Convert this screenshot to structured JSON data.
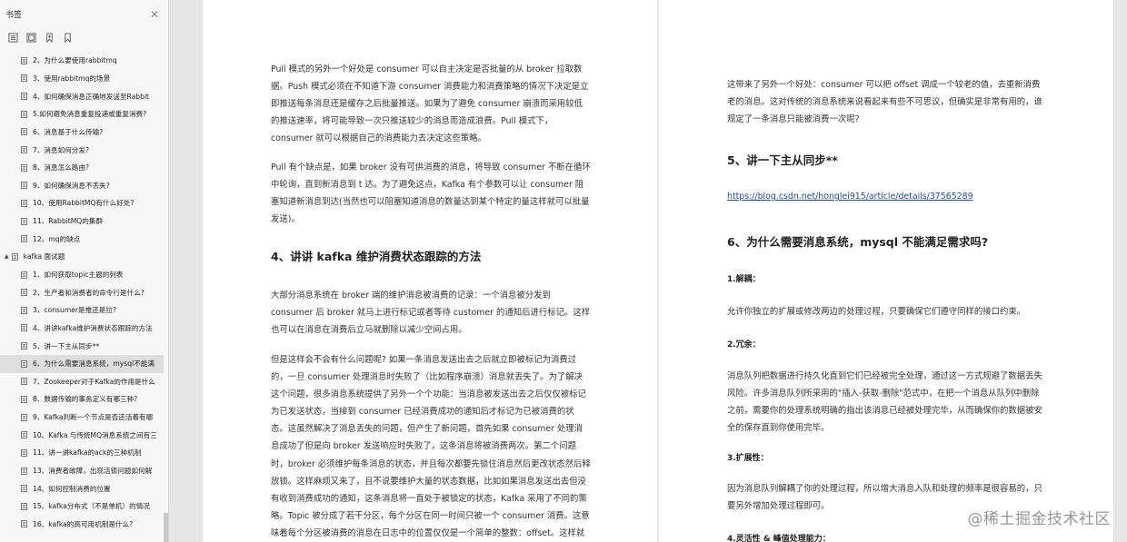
{
  "sidebar": {
    "title": "书签",
    "close_icon": "✕",
    "tools": [
      "expand-all-icon",
      "collapse-all-icon",
      "bookmark-add-icon",
      "bookmark-icon"
    ],
    "items": [
      {
        "label": "2、为什么要使用rabbitmq",
        "level": "child"
      },
      {
        "label": "3、使用rabbitmq的场景",
        "level": "child"
      },
      {
        "label": "4、如何确保消息正确地发送至Rabbit",
        "level": "child"
      },
      {
        "label": "5.如何避免消息重复投递或重复消费?",
        "level": "child"
      },
      {
        "label": "6、消息基于什么传输?",
        "level": "child"
      },
      {
        "label": "7、消息如何分发?",
        "level": "child"
      },
      {
        "label": "8、消息怎么路由?",
        "level": "child"
      },
      {
        "label": "9、如何确保消息不丢失?",
        "level": "child"
      },
      {
        "label": "10、使用RabbitMQ有什么好处?",
        "level": "child"
      },
      {
        "label": "11、RabbitMQ的集群",
        "level": "child"
      },
      {
        "label": "12、mq的缺点",
        "level": "child"
      },
      {
        "label": "kafka 面试题",
        "level": "parent"
      },
      {
        "label": "1、如何获取topic主题的列表",
        "level": "child"
      },
      {
        "label": "2、生产者和消费者的命令行是什么?",
        "level": "child"
      },
      {
        "label": "3、consumer是推还是拉?",
        "level": "child"
      },
      {
        "label": "4、讲讲kafka维护消费状态跟踪的方法",
        "level": "child"
      },
      {
        "label": "5、讲一下主从同步**",
        "level": "child"
      },
      {
        "label": "6、为什么需要消息系统，mysql不能满",
        "level": "child",
        "selected": true
      },
      {
        "label": "7、Zookeeper对于Kafka的作用是什么",
        "level": "child"
      },
      {
        "label": "8、数据传输的事务定义有哪三种?",
        "level": "child"
      },
      {
        "label": "9、Kafka判断一个节点是否还活着有哪",
        "level": "child"
      },
      {
        "label": "10、Kafka 与传统MQ消息系统之间有三",
        "level": "child"
      },
      {
        "label": "11、讲一讲kafka的ack的三种机制",
        "level": "child"
      },
      {
        "label": "13、消费者故障，出现活锁问题如何解",
        "level": "child"
      },
      {
        "label": "14、如何控制消费的位置",
        "level": "child"
      },
      {
        "label": "15、kafka分布式（不是单机）的情况",
        "level": "child"
      },
      {
        "label": "16、kafka的高可用机制是什么?",
        "level": "child"
      }
    ]
  },
  "left_page": {
    "para1": "Pull 模式的另外一个好处是 consumer 可以自主决定是否批量的从 broker 拉取数据。Push 模式必须在不知道下游 consumer 消费能力和消费策略的情况下决定是立即推送每条消息还是缓存之后批量推送。如果为了避免 consumer 崩溃而采用较低的推送速率，将可能导致一次只推送较少的消息而造成浪费。Pull 模式下，consumer 就可以根据自己的消费能力去决定这些策略。",
    "para2": "Pull 有个缺点是，如果 broker 没有可供消费的消息，将导致 consumer 不断在循环中轮询，直到新消息到 t 达。为了避免这点，Kafka 有个参数可以让 consumer 阻塞知道新消息到达(当然也可以阻塞知道消息的数量达到某个特定的量这样就可以批量发送)。",
    "heading4": "4、讲讲 kafka 维护消费状态跟踪的方法",
    "para3": "大部分消息系统在 broker 端的维护消息被消费的记录：一个消息被分发到 consumer 后 broker 就马上进行标记或者等待 customer 的通知后进行标记。这样也可以在消息在消费后立马就删除以减少空间占用。",
    "para4": "但是这样会不会有什么问题呢? 如果一条消息发送出去之后就立即被标记为消费过的，一旦 consumer 处理消息时失败了（比如程序崩溃）消息就丢失了。为了解决这个问题，很多消息系统提供了另外一个个功能：当消息被发送出去之后仅仅被标记为已发送状态，当接到 consumer 已经消费成功的通知后才标记为已被消费的状态。这虽然解决了消息丢失的问题，但产生了新问题，首先如果 consumer 处理消息成功了但是向 broker 发送响应时失败了，这条消息将被消费两次。第二个问题时，broker 必须维护每条消息的状态，并且每次都要先锁住消息然后更改状态然后释放锁。这样麻烦又来了，且不说要维护大量的状态数据，比如如果消息发送出去但没有收到消费成功的通知，这条消息将一直处于被锁定的状态，Kafka 采用了不同的策略。Topic 被分成了若干分区，每个分区在同一时间只被一个 consumer 消费。这意味着每个分区被消费的消息在日志中的位置仅仅是一个简单的整数：offset。这样就很容易标记每个分区消费状态就很容易了，仅仅需要"
  },
  "right_page": {
    "para1": "这带来了另外一个好处：consumer 可以把 offset 调成一个较老的值，去重新消费老的消息。这对传统的消息系统来说看起来有些不可思议，但确实是非常有用的，谁规定了一条消息只能被消费一次呢?",
    "heading5": "5、讲一下主从同步**",
    "link": "https://blog.csdn.net/honglei915/article/details/37565289",
    "heading6": "6、为什么需要消息系统，mysql 不能满足需求吗?",
    "sub1": "1.解耦：",
    "para2": "允许你独立的扩展或修改两边的处理过程，只要确保它们遵守同样的接口约束。",
    "sub2": "2.冗余：",
    "para3": "消息队列把数据进行持久化直到它们已经被完全处理，通过这一方式规避了数据丢失风险。许多消息队列所采用的\"插入-获取-删除\"范式中，在把一个消息从队列中删除之前，需要你的处理系统明确的指出该消息已经被处理完毕，从而确保你的数据被安全的保存直到你使用完毕。",
    "sub3": "3.扩展性：",
    "para4": "因为消息队列解耦了你的处理过程，所以增大消息入队和处理的频率是很容易的，只要另外增加处理过程即可。",
    "sub4": "4.灵活性 & 峰值处理能力："
  },
  "watermark": "@稀土掘金技术社区"
}
